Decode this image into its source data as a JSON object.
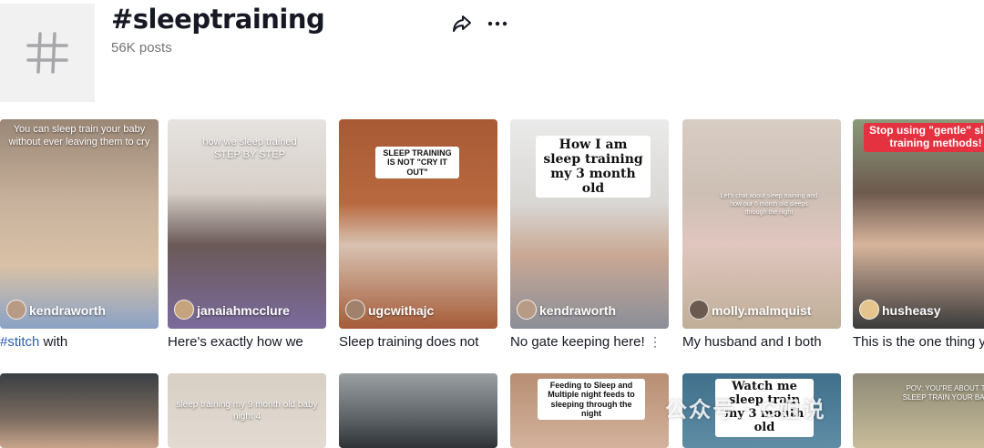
{
  "header": {
    "title": "#sleeptraining",
    "posts": "56K posts",
    "hero_icon": "hashtag-icon",
    "share_icon": "share-arrow-icon",
    "more_icon": "more-horizontal-icon"
  },
  "videos": [
    {
      "username": "kendraworth",
      "caption": "You can sleep train your baby without ever leaving them to cry",
      "desc_hash": "#stitch",
      "desc": " with"
    },
    {
      "username": "janaiahmcclure",
      "caption": "how we sleep trained STEP BY STEP",
      "desc": "Here's exactly how we"
    },
    {
      "username": "ugcwithajc",
      "caption": "SLEEP TRAINING IS NOT \"CRY IT OUT\"",
      "desc": "Sleep training does not"
    },
    {
      "username": "kendraworth",
      "caption": "How I am sleep training my 3 month old",
      "desc": "No gate keeping here!"
    },
    {
      "username": "molly.malmquist",
      "caption": "Let's chat about sleep training and how our 6 month old sleeps through the night",
      "desc": "My husband and I both"
    },
    {
      "username": "husheasy",
      "caption": "Stop using \"gentle\" sleep training methods!",
      "desc": "This is the one thing y"
    }
  ],
  "row2": [
    {
      "caption": ""
    },
    {
      "caption": "sleep training my 9 month old baby night 4"
    },
    {
      "caption": ""
    },
    {
      "caption": "Feeding to Sleep and Multiple night feeds to sleeping through the night"
    },
    {
      "caption": "Watch me sleep train my 3 month old"
    },
    {
      "caption": "POV: YOU'RE ABOUT TO SLEEP TRAIN YOUR BABY"
    }
  ],
  "watermark": "公众号 · C姐说",
  "colors": {
    "hashtag_link": "#2b5db9",
    "secondary_text": "#757575",
    "tile_bg": "#f1f1f2"
  }
}
